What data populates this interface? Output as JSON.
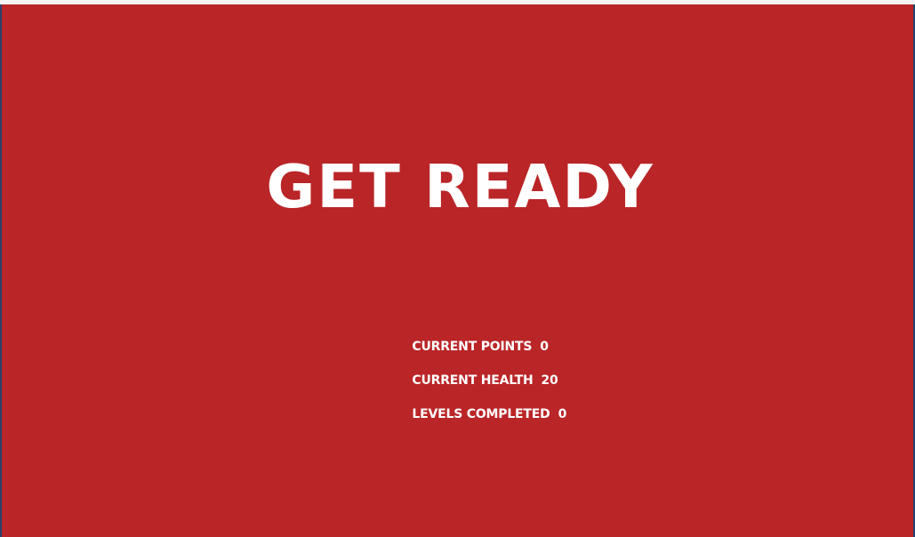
{
  "screen": {
    "title": "GET READY",
    "background_color": "#ba2527",
    "text_color": "#ffffff"
  },
  "stats": [
    {
      "label": "CURRENT POINTS",
      "value": "0"
    },
    {
      "label": "CURRENT HEALTH",
      "value": "20"
    },
    {
      "label": "LEVELS COMPLETED",
      "value": "0"
    }
  ]
}
